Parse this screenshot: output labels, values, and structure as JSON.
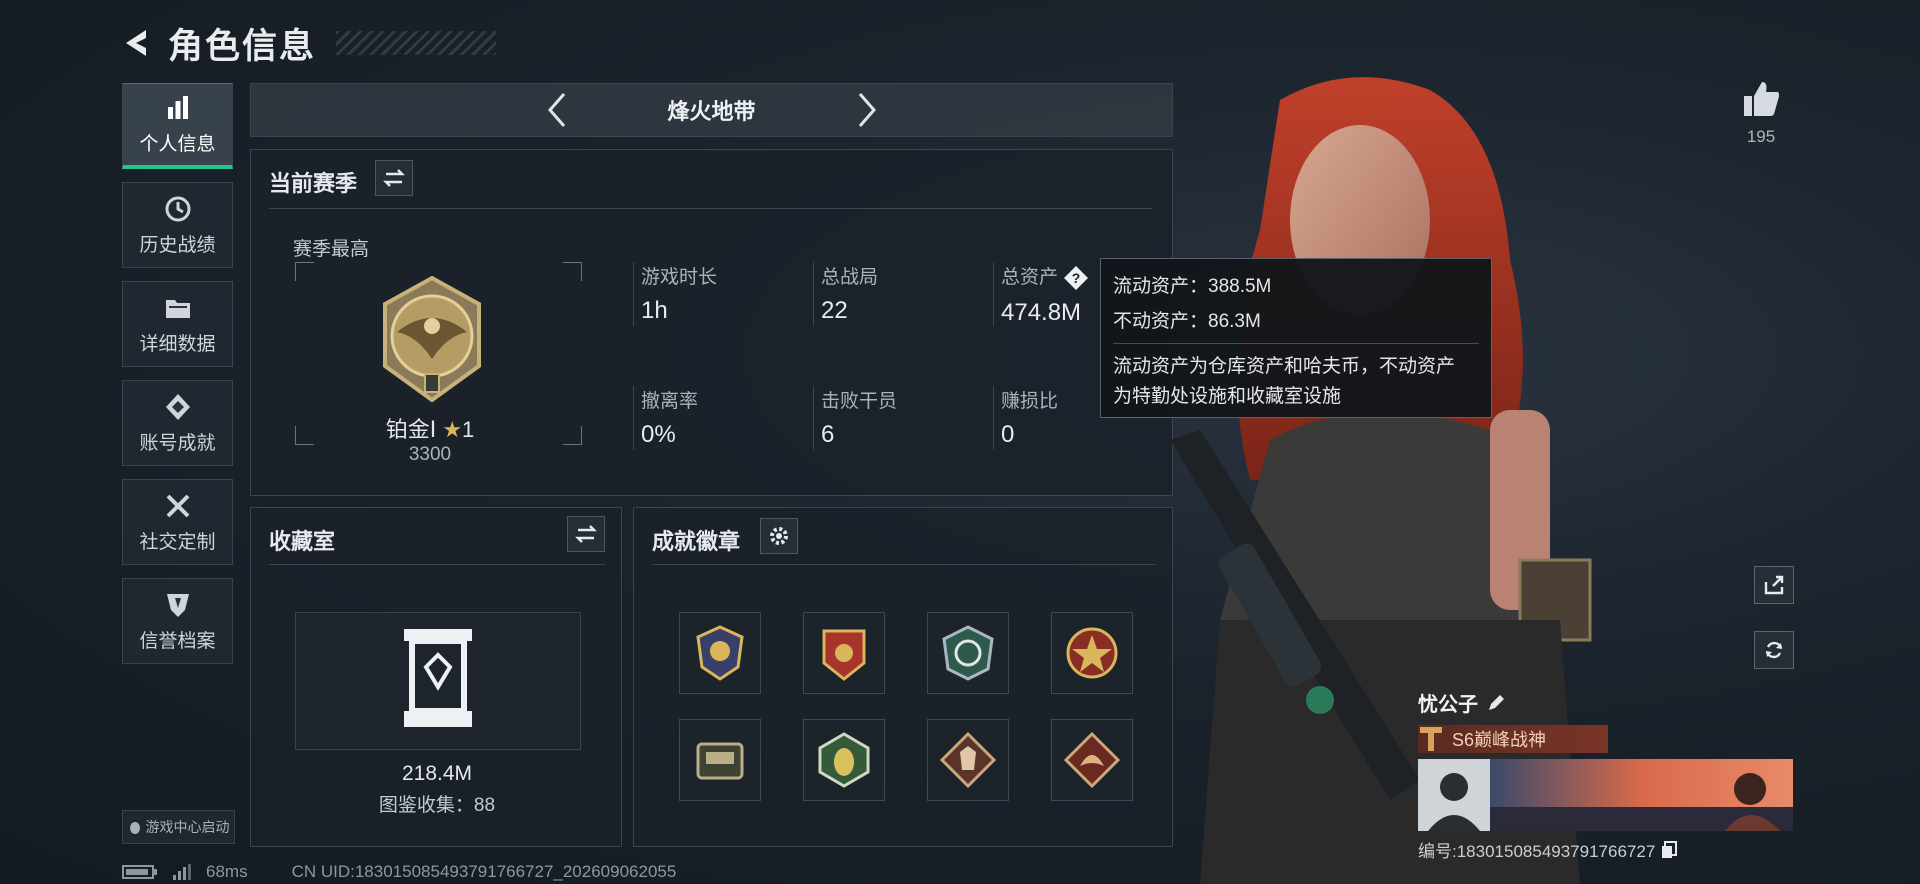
{
  "header": {
    "title": "角色信息"
  },
  "nav": {
    "items": [
      {
        "label": "个人信息",
        "icon": "bar-chart-icon",
        "active": true
      },
      {
        "label": "历史战绩",
        "icon": "history-icon"
      },
      {
        "label": "详细数据",
        "icon": "folder-icon"
      },
      {
        "label": "账号成就",
        "icon": "achievement-icon"
      },
      {
        "label": "社交定制",
        "icon": "tools-icon"
      },
      {
        "label": "信誉档案",
        "icon": "shield-icon"
      }
    ],
    "game_center": "游戏中心启动"
  },
  "mode": {
    "label": "烽火地带"
  },
  "season": {
    "title": "当前赛季",
    "best_label": "赛季最高",
    "rank_name": "铂金Ⅰ",
    "rank_stars": "1",
    "rank_score": "3300",
    "stats": [
      {
        "label": "游戏时长",
        "value": "1h"
      },
      {
        "label": "总战局",
        "value": "22"
      },
      {
        "label": "总资产",
        "value": "474.8M"
      },
      {
        "label": "撤离率",
        "value": "0%"
      },
      {
        "label": "击败干员",
        "value": "6"
      },
      {
        "label": "赚损比",
        "value": "0"
      }
    ]
  },
  "tooltip": {
    "liquid": "流动资产：388.5M",
    "fixed": "不动资产：86.3M",
    "desc_line1": "流动资产为仓库资产和哈夫币，不动资产",
    "desc_line2": "为特勤处设施和收藏室设施"
  },
  "collection": {
    "title": "收藏室",
    "value": "218.4M",
    "collect_label": "图鉴收集：88"
  },
  "badges": {
    "title": "成就徽章",
    "count": 8
  },
  "right": {
    "likes": "195"
  },
  "player": {
    "name": "忧公子",
    "rank_tag": "S6巅峰战神",
    "uid": "编号:18301508549379176672​7"
  },
  "footer": {
    "ping": "68ms",
    "uid_line": "CN UID:18301508549379176672​7_202609062055"
  },
  "colors": {
    "accent": "#23c48e",
    "tag": "#7a3428"
  }
}
